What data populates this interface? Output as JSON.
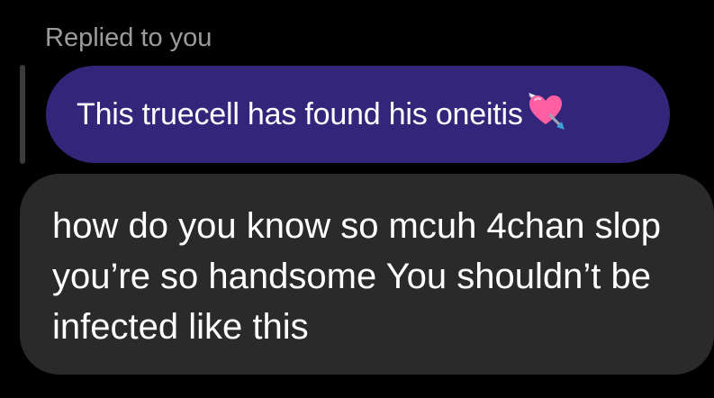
{
  "reply": {
    "caption": "Replied to you",
    "quoted_message": "This truecell has found his oneitis",
    "quoted_emoji": "heart-with-arrow-icon",
    "bubble_color": "#33267a"
  },
  "message": {
    "text": "how do you know so mcuh 4chan slop you’re so handsome You shouldn’t be infected like this",
    "bubble_color": "#2a2a2a"
  }
}
